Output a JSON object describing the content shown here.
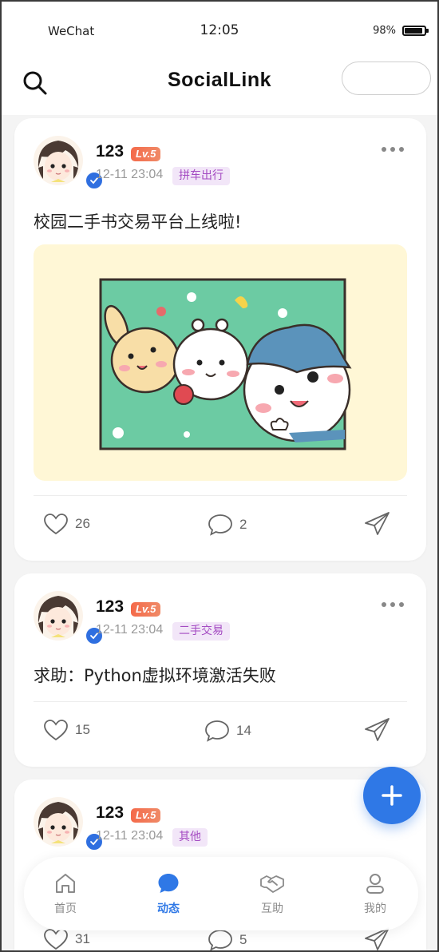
{
  "status_bar": {
    "carrier": "WeChat",
    "time": "12:05",
    "battery": "98%"
  },
  "header": {
    "title": "SocialLink"
  },
  "posts": [
    {
      "username": "123",
      "level": "Lv.5",
      "time": "12-11 23:04",
      "tag": "拼车出行",
      "text": "校园二手书交易平台上线啦!",
      "likes": "26",
      "comments": "2"
    },
    {
      "username": "123",
      "level": "Lv.5",
      "time": "12-11 23:04",
      "tag": "二手交易",
      "text": "求助：Python虚拟环境激活失败",
      "likes": "15",
      "comments": "14"
    },
    {
      "username": "123",
      "level": "Lv.5",
      "time": "12-11 23:04",
      "tag": "其他",
      "text": "",
      "likes": "31",
      "comments": "5"
    }
  ],
  "bottom_nav": {
    "items": [
      {
        "label": "首页",
        "icon": "home-icon"
      },
      {
        "label": "动态",
        "icon": "chat-bubble-icon",
        "active": true
      },
      {
        "label": "互助",
        "icon": "handshake-icon"
      },
      {
        "label": "我的",
        "icon": "profile-icon"
      }
    ]
  },
  "colors": {
    "accent": "#2f78e6",
    "tag_bg": "#f2e6f8",
    "tag_text": "#a44bc2",
    "level_badge": "#f46a4a"
  }
}
